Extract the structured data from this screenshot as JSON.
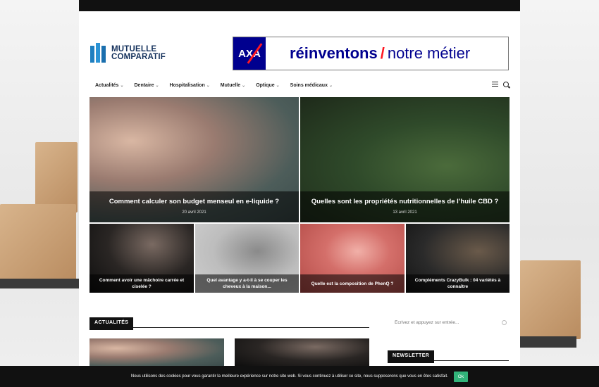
{
  "logo": {
    "line1": "MUTUELLE",
    "line2": "COMPARATIF"
  },
  "banner": {
    "brand": "AXA",
    "text_bold": "réinventons",
    "slash": "/",
    "text_rest": "notre métier"
  },
  "nav": {
    "items": [
      {
        "label": "Actualités"
      },
      {
        "label": "Dentaire"
      },
      {
        "label": "Hospitalisation"
      },
      {
        "label": "Mutuelle"
      },
      {
        "label": "Optique"
      },
      {
        "label": "Soins médicaux"
      }
    ]
  },
  "featured": [
    {
      "title": "Comment calculer son budget menseul en e-liquide ?",
      "date": "20 avril 2021"
    },
    {
      "title": "Quelles sont les propriétés nutritionnelles de l’huile CBD ?",
      "date": "13 avril 2021"
    }
  ],
  "grid": [
    {
      "title": "Comment avoir une mâchoire carrée et ciselée ?"
    },
    {
      "title": "Quel avantage y a-t-il à se couper les cheveux à la maison..."
    },
    {
      "title": "Quelle est la composition de PhenQ ?"
    },
    {
      "title": "Compléments CrazyBulk : 04 variétés à connaître"
    }
  ],
  "section": {
    "title": "ACTUALITÉS"
  },
  "sidebar": {
    "search_placeholder": "Écrivez et appuyez sur entrée...",
    "newsletter_title": "NEWSLETTER"
  },
  "cookie": {
    "text": "Nous utilisons des cookies pour vous garantir la meilleure expérience sur notre site web. Si vous continuez à utiliser ce site, nous supposerons que vous en êtes satisfait.",
    "ok_label": "Ok"
  }
}
